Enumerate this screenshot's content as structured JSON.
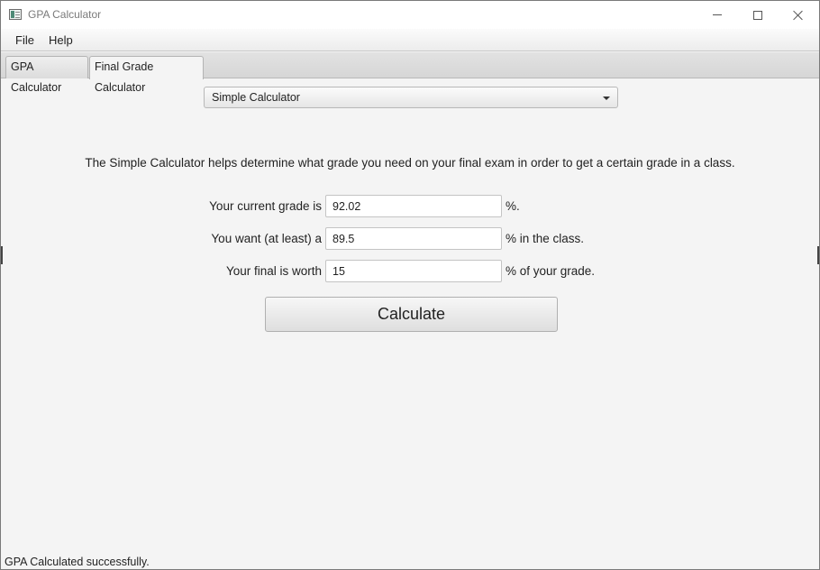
{
  "window": {
    "title": "GPA Calculator",
    "icon": "app-icon"
  },
  "menu": {
    "items": [
      "File",
      "Help"
    ]
  },
  "tabs": [
    {
      "label": "GPA Calculator",
      "selected": false
    },
    {
      "label": "Final Grade Calculator",
      "selected": true
    }
  ],
  "calculator_type": {
    "selected": "Simple Calculator"
  },
  "description": "The Simple Calculator helps determine what grade you need on your final exam in order to get a certain grade in a class.",
  "form": {
    "current_grade": {
      "label": "Your current grade is",
      "value": "92.02",
      "suffix": "%."
    },
    "target_grade": {
      "label": "You want (at least) a",
      "value": "89.5",
      "suffix": "% in the class."
    },
    "final_weight": {
      "label": "Your final is worth",
      "value": "15",
      "suffix": "% of your grade."
    }
  },
  "calculate_button": {
    "label": "Calculate"
  },
  "status": "GPA Calculated successfully."
}
